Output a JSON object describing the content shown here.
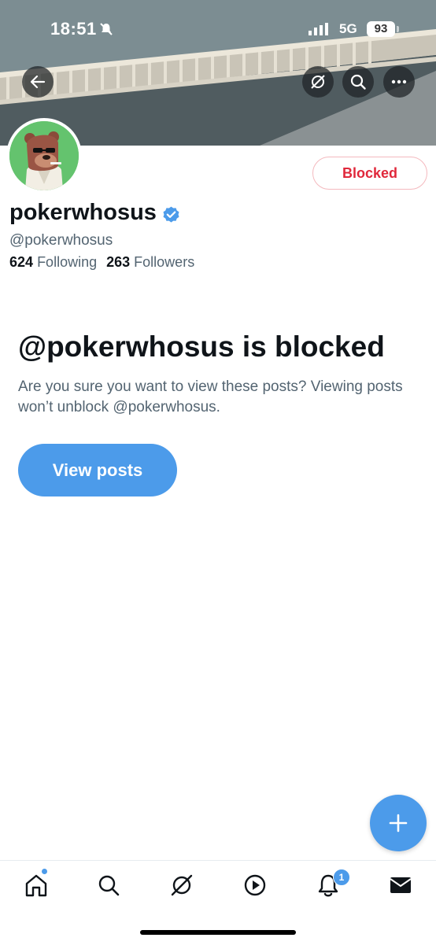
{
  "status_bar": {
    "time": "18:51",
    "network": "5G",
    "battery": "93"
  },
  "profile": {
    "display_name": "pokerwhosus",
    "handle": "@pokerwhosus",
    "following_count": "624",
    "following_label": "Following",
    "followers_count": "263",
    "followers_label": "Followers",
    "blocked_button": "Blocked"
  },
  "blocked_notice": {
    "title": "@pokerwhosus is blocked",
    "description": "Are you sure you want to view these posts? Viewing posts won’t unblock @pokerwhosus.",
    "view_button": "View posts"
  },
  "tabbar": {
    "notifications_badge": "1"
  },
  "colors": {
    "accent": "#4c9bea",
    "danger": "#e0283b",
    "secondary_text": "#536471"
  }
}
